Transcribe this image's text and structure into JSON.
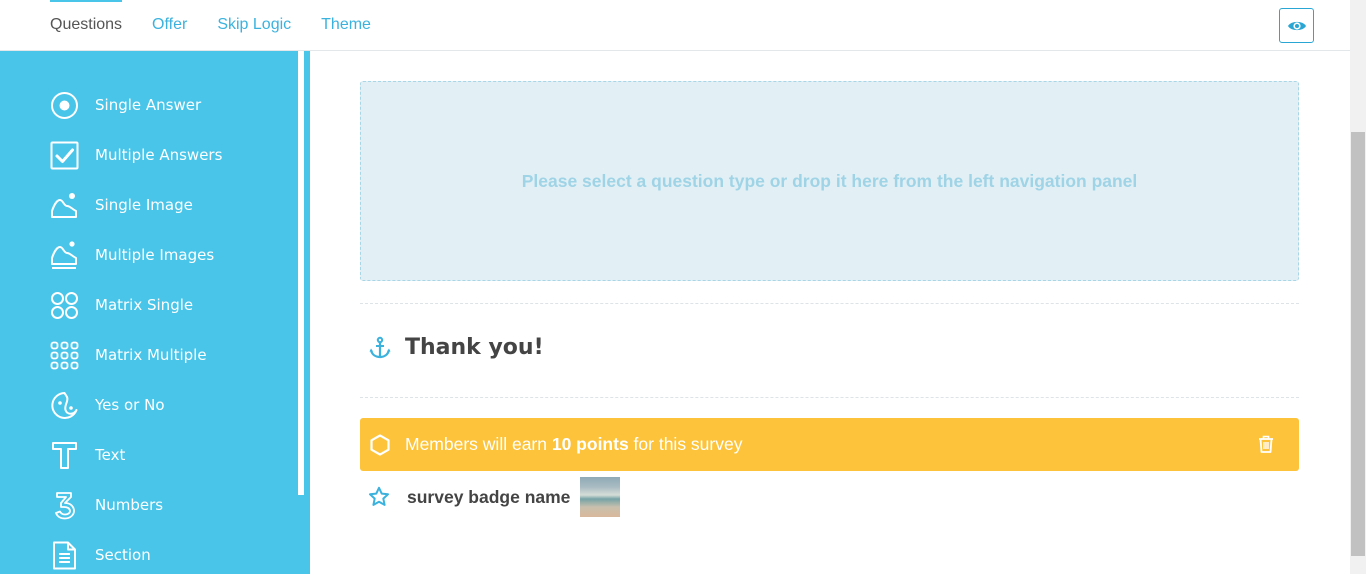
{
  "tabs": [
    {
      "label": "Questions",
      "active": true
    },
    {
      "label": "Offer"
    },
    {
      "label": "Skip Logic"
    },
    {
      "label": "Theme"
    }
  ],
  "preview": {
    "icon": "eye-icon"
  },
  "sidebar": {
    "items": [
      {
        "label": "Single Answer",
        "icon": "radio-icon"
      },
      {
        "label": "Multiple Answers",
        "icon": "checkbox-icon"
      },
      {
        "label": "Single Image",
        "icon": "image-icon"
      },
      {
        "label": "Multiple Images",
        "icon": "images-icon"
      },
      {
        "label": "Matrix Single",
        "icon": "matrix-single-icon"
      },
      {
        "label": "Matrix Multiple",
        "icon": "matrix-multiple-icon"
      },
      {
        "label": "Yes or No",
        "icon": "yes-no-icon"
      },
      {
        "label": "Text",
        "icon": "text-icon"
      },
      {
        "label": "Numbers",
        "icon": "numbers-icon"
      },
      {
        "label": "Section",
        "icon": "section-icon"
      }
    ]
  },
  "main": {
    "dropzone_text": "Please select a question type or drop it here from the left navigation panel",
    "thanks_title": "Thank you!",
    "points_prefix": "Members will earn ",
    "points_value": "10 points",
    "points_suffix": " for this survey",
    "badge_name": "survey badge name"
  },
  "colors": {
    "accent": "#49c5e9",
    "points_bar": "#fdc43b",
    "link": "#3bb2de"
  }
}
